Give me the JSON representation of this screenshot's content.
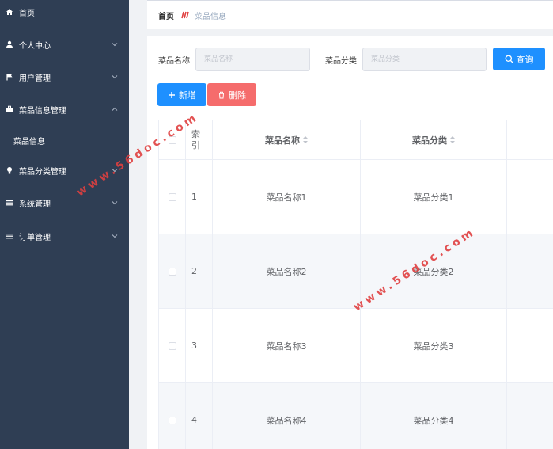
{
  "sidebar": {
    "items": [
      {
        "label": "首页",
        "icon": "home-icon"
      },
      {
        "label": "个人中心",
        "icon": "user-icon"
      },
      {
        "label": "用户管理",
        "icon": "flag-icon"
      },
      {
        "label": "菜品信息管理",
        "icon": "briefcase-icon"
      },
      {
        "label": "菜品信息",
        "icon": ""
      },
      {
        "label": "菜品分类管理",
        "icon": "bulb-icon"
      },
      {
        "label": "系统管理",
        "icon": "menu-icon"
      },
      {
        "label": "订单管理",
        "icon": "menu-icon"
      }
    ]
  },
  "breadcrumb": {
    "home": "首页",
    "current": "菜品信息"
  },
  "search": {
    "name_label": "菜品名称",
    "name_placeholder": "菜品名称",
    "category_label": "菜品分类",
    "category_placeholder": "菜品分类",
    "query_button": "查询"
  },
  "actions": {
    "add_button": "新增",
    "delete_button": "删除"
  },
  "table": {
    "headers": {
      "index": "索引",
      "name": "菜品名称",
      "category": "菜品分类"
    },
    "rows": [
      {
        "index": "1",
        "name": "菜品名称1",
        "category": "菜品分类1"
      },
      {
        "index": "2",
        "name": "菜品名称2",
        "category": "菜品分类2"
      },
      {
        "index": "3",
        "name": "菜品名称3",
        "category": "菜品分类3"
      },
      {
        "index": "4",
        "name": "菜品名称4",
        "category": "菜品分类4"
      }
    ]
  },
  "watermark": "www.56doc.com",
  "colors": {
    "sidebar_bg": "#2f3e54",
    "primary": "#1e90ff",
    "danger": "#f56c6c"
  }
}
